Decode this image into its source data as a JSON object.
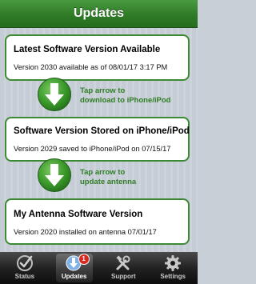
{
  "header": {
    "title": "Updates"
  },
  "cards": {
    "latest": {
      "heading": "Latest Software Version Available",
      "detail": "Version 2030 available as of 08/01/17 3:17 PM"
    },
    "stored": {
      "heading": "Software Version Stored on iPhone/iPod",
      "detail": "Version 2029 saved to iPhone/iPod on 07/15/17"
    },
    "antenna": {
      "heading": "My Antenna Software Version",
      "detail": "Version 2020 installed on antenna 07/01/17"
    }
  },
  "actions": {
    "download": {
      "line1": "Tap arrow to",
      "line2": "download to iPhone/iPod",
      "icon": "down-arrow-circle-icon"
    },
    "update": {
      "line1": "Tap arrow to",
      "line2": "update antenna",
      "icon": "down-arrow-circle-icon"
    }
  },
  "tabbar": {
    "tabs": [
      {
        "label": "Status",
        "icon": "checkmark-icon"
      },
      {
        "label": "Updates",
        "icon": "download-icon",
        "badge": "1"
      },
      {
        "label": "Support",
        "icon": "tools-icon"
      },
      {
        "label": "Settings",
        "icon": "gear-icon"
      }
    ]
  },
  "colors": {
    "accent": "#3c8a33",
    "badge": "#d8281f"
  }
}
